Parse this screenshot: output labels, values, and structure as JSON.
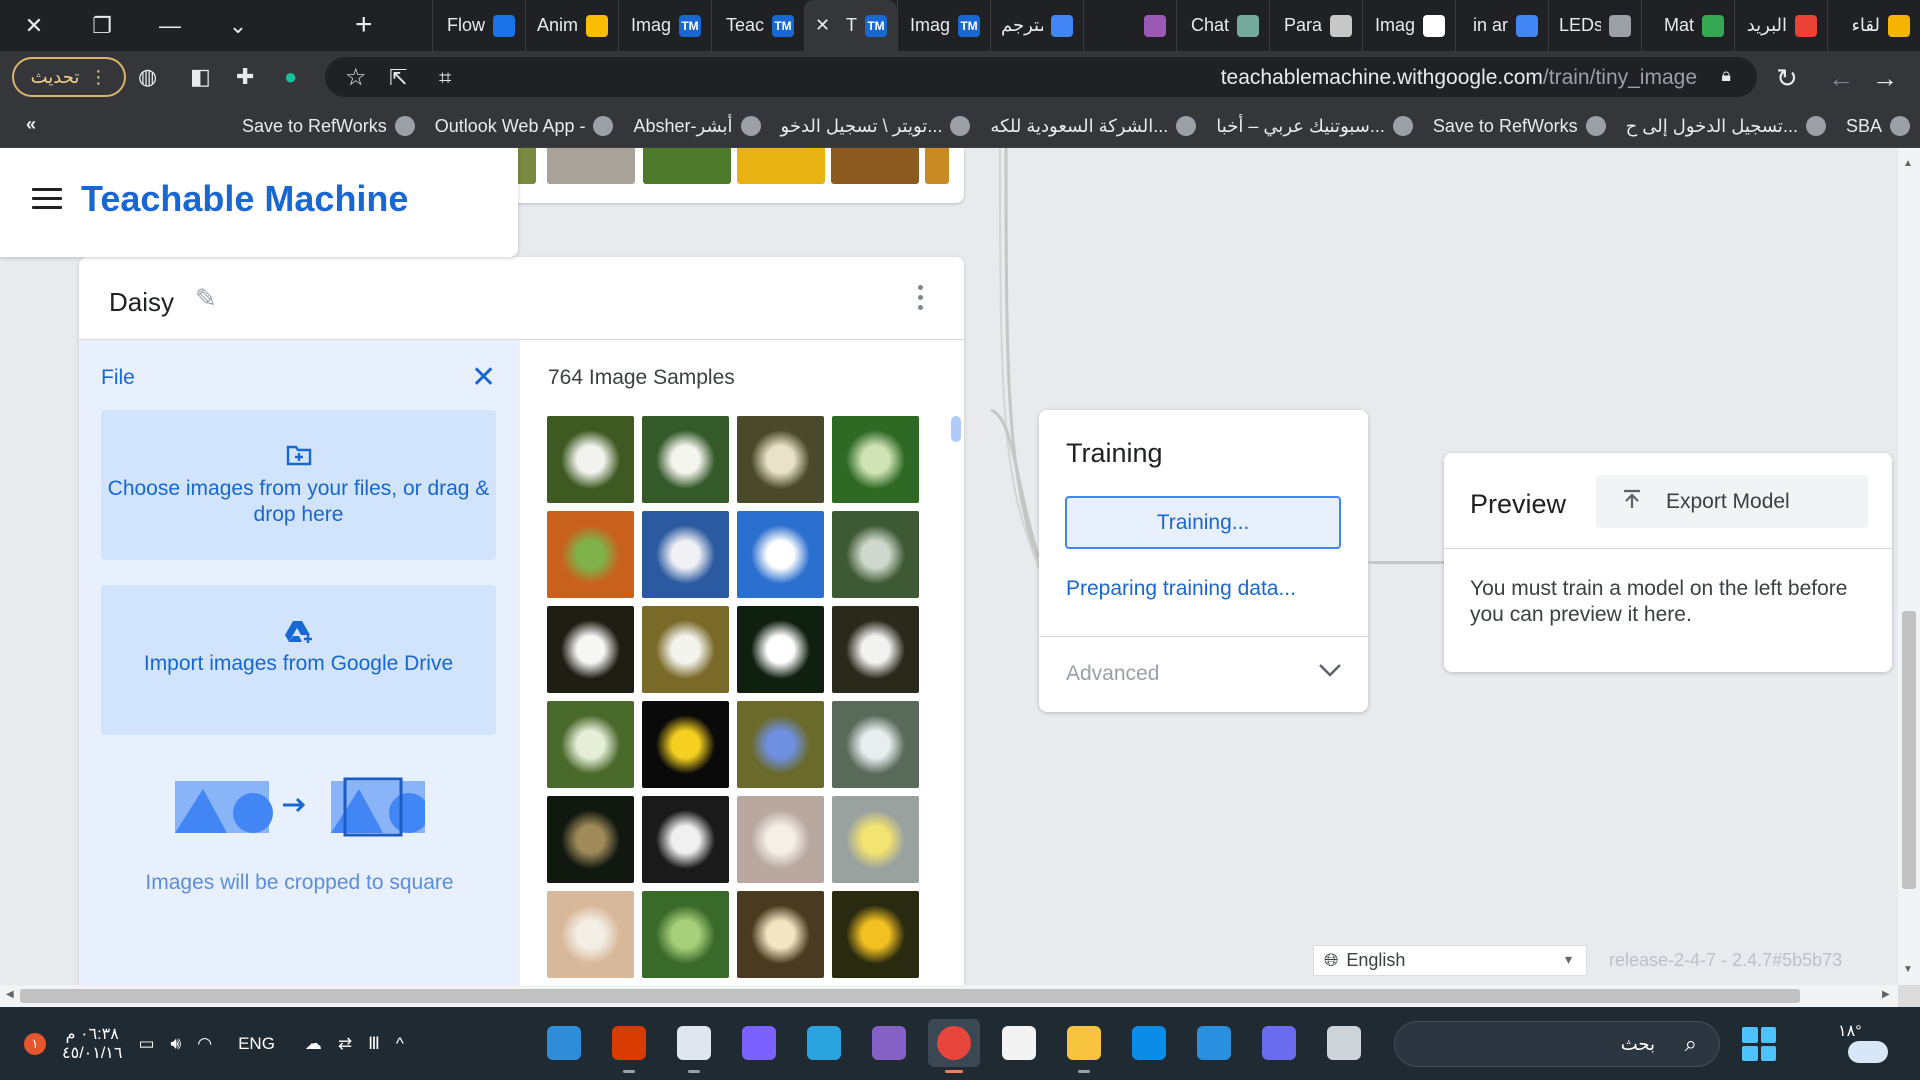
{
  "browser": {
    "tabs": [
      {
        "title": "لقاء",
        "icon": "calendar-icon",
        "color": "#f4b400"
      },
      {
        "title": "البريد",
        "icon": "gmail-icon",
        "color": "#ea4335"
      },
      {
        "title": "Mat",
        "icon": "grid-icon",
        "color": "#34a853"
      },
      {
        "title": "LEDs",
        "icon": "globe-icon",
        "color": "#9aa0a6"
      },
      {
        "title": "in ar",
        "icon": "google-icon",
        "color": "#4285f4"
      },
      {
        "title": "Imag",
        "icon": "github-icon",
        "color": "#ffffff"
      },
      {
        "title": "Para",
        "icon": "quill-icon",
        "color": "#c7c7c7"
      },
      {
        "title": "Chat",
        "icon": "chatgpt-icon",
        "color": "#74aa9c"
      },
      {
        "title": "",
        "icon": "pie-icon",
        "color": "#9b59b6"
      },
      {
        "title": "مترجم",
        "icon": "google-icon",
        "color": "#4285f4"
      },
      {
        "title": "Imag",
        "icon": "tm-icon",
        "color": "#1967d2"
      },
      {
        "title": "T",
        "icon": "tm-icon",
        "color": "#1967d2",
        "active": true
      },
      {
        "title": "Teac",
        "icon": "tm-icon",
        "color": "#1967d2"
      },
      {
        "title": "Imag",
        "icon": "tm-icon",
        "color": "#1967d2"
      },
      {
        "title": "Anim",
        "icon": "drive-icon",
        "color": "#fbbc04"
      },
      {
        "title": "Flow",
        "icon": "k-icon",
        "color": "#1a73e8"
      }
    ],
    "update_label": "تحديث",
    "url_host": "teachablemachine.withgoogle.com",
    "url_path": "/train/tiny_image",
    "bookmarks": [
      {
        "label": "SBA"
      },
      {
        "label": "تسجيل الدخول إلى ح..."
      },
      {
        "label": "Save to RefWorks"
      },
      {
        "label": "سبوتنيك عربي – أخبا..."
      },
      {
        "label": "الشركة السعودية للكه..."
      },
      {
        "label": "تويتر \\ تسجيل الدخو..."
      },
      {
        "label": "Absher-أبشر"
      },
      {
        "label": "Outlook Web App -"
      },
      {
        "label": "Save to RefWorks"
      }
    ],
    "bookmarks_more": "«"
  },
  "app": {
    "brand": "Teachable Machine",
    "class_card": {
      "name": "Daisy",
      "file_label": "File",
      "choose_files": "Choose images from your files, or drag & drop here",
      "import_drive": "Import images from Google Drive",
      "crop_note": "Images will be cropped to square",
      "sample_count": "764 Image Samples"
    },
    "training": {
      "title": "Training",
      "button": "Training...",
      "status": "Preparing training data...",
      "advanced": "Advanced"
    },
    "preview": {
      "title": "Preview",
      "export": "Export Model",
      "message": "You must train a model on the left before you can preview it here."
    },
    "language": "English",
    "release": "release-2-4-7 - 2.4.7#5b5b73"
  },
  "taskbar": {
    "time": "٠٦:٣٨ م",
    "date": "٤٥/٠١/١٦",
    "notification_count": "١",
    "lang": "ENG",
    "search_label": "بحث",
    "temperature": "١٨°"
  },
  "colors": {
    "accent": "#1967d2",
    "panel_bg": "#e8f0fe"
  }
}
